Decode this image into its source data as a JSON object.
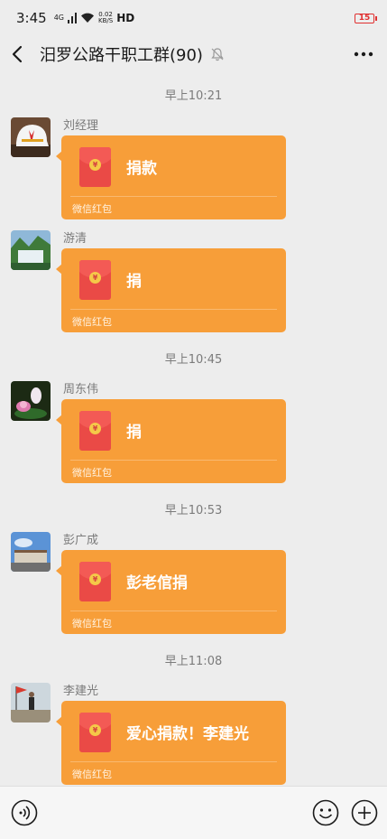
{
  "status_bar": {
    "time": "3:45",
    "signal": "4G",
    "net_speed_value": "0.02",
    "net_speed_unit": "KB/S",
    "hd": "HD",
    "battery": "15"
  },
  "header": {
    "title": "汨罗公路干职工群(90)"
  },
  "messages": [
    {
      "time": "早上10:21",
      "sender": "刘经理",
      "text": "捐款",
      "footer": "微信红包"
    },
    {
      "sender": "游清",
      "text": "捐",
      "footer": "微信红包"
    },
    {
      "time": "早上10:45",
      "sender": "周东伟",
      "text": "捐",
      "footer": "微信红包"
    },
    {
      "time": "早上10:53",
      "sender": "彭广成",
      "text": "彭老倌捐",
      "footer": "微信红包"
    },
    {
      "time": "早上11:08",
      "sender": "李建光",
      "text": "爱心捐款！李建光",
      "footer": "微信红包"
    }
  ],
  "icons": {
    "coin_symbol": "¥"
  },
  "colors": {
    "background": "#ededed",
    "red_packet": "#f79e39",
    "envelope": "#ea4a46"
  }
}
